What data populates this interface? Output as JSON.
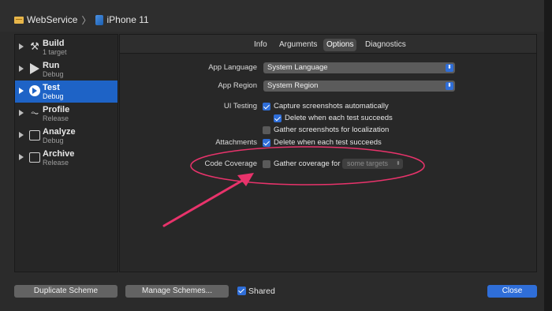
{
  "breadcrumb": {
    "project": "WebService",
    "device": "iPhone 11"
  },
  "sidebar": {
    "items": [
      {
        "name": "Build",
        "sub": "1 target",
        "icon": "hammer-icon"
      },
      {
        "name": "Run",
        "sub": "Debug",
        "icon": "play-icon"
      },
      {
        "name": "Test",
        "sub": "Debug",
        "icon": "test-diamond-icon"
      },
      {
        "name": "Profile",
        "sub": "Release",
        "icon": "instruments-icon"
      },
      {
        "name": "Analyze",
        "sub": "Debug",
        "icon": "analyze-icon"
      },
      {
        "name": "Archive",
        "sub": "Release",
        "icon": "archive-icon"
      }
    ]
  },
  "tabs": [
    "Info",
    "Arguments",
    "Options",
    "Diagnostics"
  ],
  "options": {
    "app_language_label": "App Language",
    "app_language_value": "System Language",
    "app_region_label": "App Region",
    "app_region_value": "System Region",
    "ui_testing_label": "UI Testing",
    "capture_screenshots": "Capture screenshots automatically",
    "delete_when_succeed": "Delete when each test succeeds",
    "gather_screenshots": "Gather screenshots for localization",
    "attachments_label": "Attachments",
    "attachments_delete": "Delete when each test succeeds",
    "code_coverage_label": "Code Coverage",
    "gather_coverage": "Gather coverage for",
    "coverage_targets": "some targets"
  },
  "footer": {
    "duplicate": "Duplicate Scheme",
    "manage": "Manage Schemes...",
    "shared": "Shared",
    "close": "Close"
  },
  "colors": {
    "accent": "#2f6ed8",
    "annotation": "#e8336b"
  }
}
